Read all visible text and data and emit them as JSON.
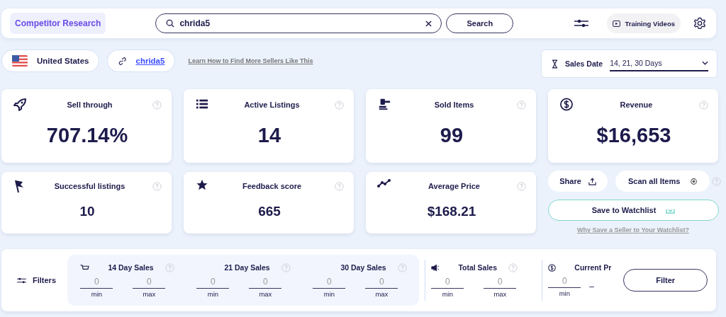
{
  "top_bar": {
    "section": "Competitor Research",
    "search": {
      "value": "chrida5"
    },
    "search_button": "Search",
    "training_button": "Training Videos"
  },
  "seller_bar": {
    "country": "United States",
    "seller_link": "chrida5",
    "help_link": "Learn How to Find More Sellers Like This",
    "sales_date": {
      "label": "Sales Date",
      "value": "14, 21, 30 Days"
    }
  },
  "metrics": [
    {
      "title": "Sell through",
      "value": "707.14%",
      "kind": "large",
      "help": true
    },
    {
      "title": "Active Listings",
      "value": "14",
      "kind": "large",
      "help": true
    },
    {
      "title": "Sold Items",
      "value": "99",
      "kind": "large",
      "help": true
    },
    {
      "title": "Revenue",
      "value": "$16,653",
      "kind": "large",
      "help": true
    },
    {
      "title": "Successful listings",
      "value": "10",
      "kind": "small",
      "help": true
    },
    {
      "title": "Feedback score",
      "value": "665",
      "kind": "small",
      "help": true
    },
    {
      "title": "Average Price",
      "value": "$168.21",
      "kind": "small",
      "help": true
    }
  ],
  "actions": {
    "share": "Share",
    "scan": "Scan all Items",
    "scan_help": true,
    "watchlist": "Save to Watchlist",
    "watchlist_link": "Why Save a Seller to Your Watchlist?"
  },
  "filters": {
    "label": "Filters",
    "panels": [
      {
        "kind": "shaded",
        "groups": [
          {
            "label": "14 Day Sales",
            "help": true,
            "fields": [
              {
                "placeholder": "0",
                "caption": "min"
              },
              {
                "placeholder": "0",
                "caption": "max"
              }
            ]
          },
          {
            "label": "21 Day Sales",
            "help": true,
            "fields": [
              {
                "placeholder": "0",
                "caption": "min"
              },
              {
                "placeholder": "0",
                "caption": "max"
              }
            ]
          },
          {
            "label": "30 Day Sales",
            "help": true,
            "fields": [
              {
                "placeholder": "0",
                "caption": "min"
              },
              {
                "placeholder": "0",
                "caption": "max"
              }
            ]
          }
        ]
      },
      {
        "kind": "plain",
        "groups": [
          {
            "label": "Total Sales",
            "help": true,
            "fields": [
              {
                "placeholder": "0",
                "caption": "min"
              },
              {
                "placeholder": "0",
                "caption": "max"
              }
            ]
          }
        ]
      },
      {
        "kind": "plain",
        "groups": [
          {
            "label": "Current Pr",
            "fields": [
              {
                "placeholder": "0",
                "caption": "min"
              }
            ],
            "separator": "–"
          }
        ]
      }
    ],
    "button": "Filter"
  }
}
